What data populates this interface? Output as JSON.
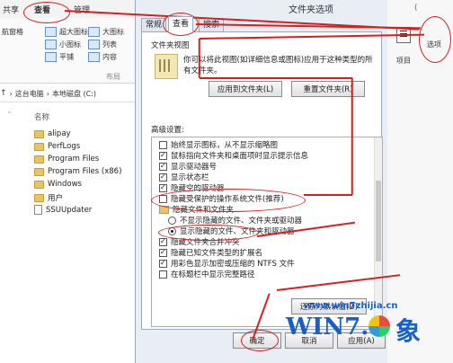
{
  "ribbon": {
    "tabs": [
      "共享",
      "查看",
      "管理"
    ],
    "left_item": "航窗格",
    "items": [
      {
        "label": "超大图标",
        "icon": "xl-icon"
      },
      {
        "label": "大图标",
        "icon": "large-icon"
      },
      {
        "label": "小图标",
        "icon": "small-icon"
      },
      {
        "label": "列表",
        "icon": "list-icon"
      },
      {
        "label": "平铺",
        "icon": "tile-icon"
      },
      {
        "label": "内容",
        "icon": "content-icon"
      }
    ],
    "layout_group": "布局",
    "right_top": "(",
    "right_options": "选项",
    "right_item": "项目"
  },
  "address": {
    "path": [
      "这台电脑",
      "本地磁盘 (C:)"
    ]
  },
  "filelist": {
    "header": "名称",
    "files": [
      {
        "name": "alipay",
        "type": "folder"
      },
      {
        "name": "PerfLogs",
        "type": "folder"
      },
      {
        "name": "Program Files",
        "type": "folder"
      },
      {
        "name": "Program Files (x86)",
        "type": "folder"
      },
      {
        "name": "Windows",
        "type": "folder"
      },
      {
        "name": "用户",
        "type": "folder"
      },
      {
        "name": "SSUUpdater",
        "type": "file"
      }
    ]
  },
  "dialog": {
    "title": "文件夹选项",
    "tabs": [
      "常规",
      "查看",
      "搜索"
    ],
    "folder_view": {
      "heading": "文件夹视图",
      "desc_line1": "你可以将此视图(如详细信息或图标)应用于这种类型的所",
      "desc_line2": "有文件夹。",
      "apply_button": "应用到文件夹(L)",
      "reset_button": "重置文件夹(R)"
    },
    "advanced": {
      "heading": "高级设置:",
      "options": [
        {
          "kind": "checkbox",
          "checked": false,
          "label": "始终显示图标，从不显示缩略图"
        },
        {
          "kind": "checkbox",
          "checked": true,
          "label": "鼠标指向文件夹和桌面项时显示提示信息"
        },
        {
          "kind": "checkbox",
          "checked": true,
          "label": "显示驱动器号"
        },
        {
          "kind": "checkbox",
          "checked": true,
          "label": "显示状态栏"
        },
        {
          "kind": "checkbox",
          "checked": true,
          "label": "隐藏空的驱动器"
        },
        {
          "kind": "checkbox",
          "checked": false,
          "label": "隐藏受保护的操作系统文件(推荐)"
        },
        {
          "kind": "folder",
          "checked": false,
          "label": "隐藏文件和文件夹"
        },
        {
          "kind": "radio",
          "checked": false,
          "label": "不显示隐藏的文件、文件夹或驱动器"
        },
        {
          "kind": "radio",
          "checked": true,
          "label": "显示隐藏的文件、文件夹和驱动器"
        },
        {
          "kind": "checkbox",
          "checked": true,
          "label": "隐藏文件夹合并冲突"
        },
        {
          "kind": "checkbox",
          "checked": true,
          "label": "隐藏已知文件类型的扩展名"
        },
        {
          "kind": "checkbox",
          "checked": true,
          "label": "用彩色显示加密或压缩的 NTFS 文件"
        },
        {
          "kind": "checkbox",
          "checked": false,
          "label": "在标题栏中显示完整路径"
        }
      ],
      "restore_defaults": "还原为默认值(D)"
    },
    "footer": {
      "ok": "确定",
      "cancel": "取消",
      "apply": "应用(A)"
    }
  },
  "watermark": {
    "site": "www.win7zhijia.cn",
    "logo_text": "WIN7.",
    "logo_char": "象"
  },
  "colors": {
    "annotation": "#d42020",
    "dialog_bg": "#e9eef5",
    "logo_blue": "#1a5fc4"
  }
}
